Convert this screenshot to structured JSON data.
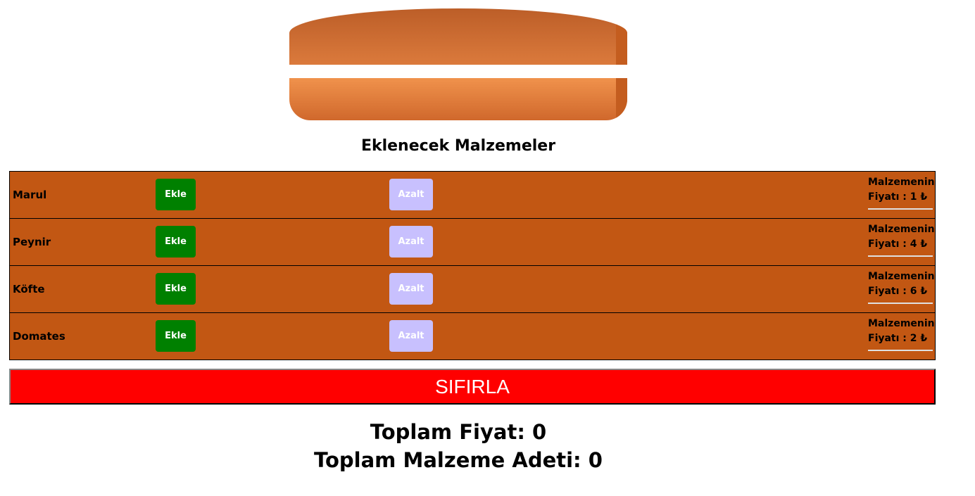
{
  "section_title": "Eklenecek Malzemeler",
  "buttons": {
    "add_label": "Ekle",
    "decrease_label": "Azalt",
    "reset_label": "SIFIRLA"
  },
  "ingredients": [
    {
      "name": "Marul",
      "price_line1": "Malzemenin",
      "price_line2": "Fiyatı : 1 ₺"
    },
    {
      "name": "Peynir",
      "price_line1": "Malzemenin",
      "price_line2": "Fiyatı : 4 ₺"
    },
    {
      "name": "Köfte",
      "price_line1": "Malzemenin",
      "price_line2": "Fiyatı : 6 ₺"
    },
    {
      "name": "Domates",
      "price_line1": "Malzemenin",
      "price_line2": "Fiyatı : 2 ₺"
    }
  ],
  "totals": {
    "total_price": "Toplam Fiyat: 0",
    "total_count": "Toplam Malzeme Adeti: 0"
  },
  "colors": {
    "row_background": "#c25713",
    "add_button": "#008000",
    "decrease_button": "#c8c0fe",
    "reset_button": "#ff0000",
    "bun": "#d9763a"
  }
}
